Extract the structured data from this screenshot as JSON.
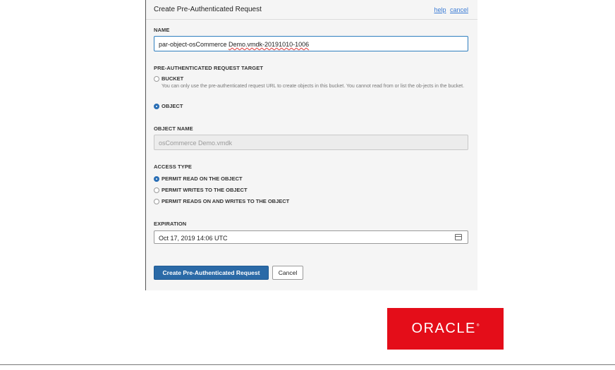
{
  "dialog": {
    "title": "Create Pre-Authenticated Request",
    "help_link": "help",
    "cancel_link": "cancel"
  },
  "name": {
    "label": "NAME",
    "value_prefix": "par-object-osCommerce ",
    "value_flagged": "Demo.vmdk-20191010-1006"
  },
  "target": {
    "label": "PRE-AUTHENTICATED REQUEST TARGET",
    "options": [
      {
        "label": "BUCKET",
        "selected": false,
        "help": "You can only use the pre-authenticated request URL to create objects in this bucket. You cannot read from or list the ob-jects in the bucket."
      },
      {
        "label": "OBJECT",
        "selected": true
      }
    ]
  },
  "object_name": {
    "label": "OBJECT NAME",
    "value": "osCommerce Demo.vmdk"
  },
  "access_type": {
    "label": "ACCESS TYPE",
    "options": [
      {
        "label": "PERMIT READ ON THE OBJECT",
        "selected": true
      },
      {
        "label": "PERMIT WRITES TO THE OBJECT",
        "selected": false
      },
      {
        "label": "PERMIT READS ON AND WRITES TO THE OBJECT",
        "selected": false
      }
    ]
  },
  "expiration": {
    "label": "EXPIRATION",
    "value": "Oct 17, 2019 14:06 UTC",
    "icon": "calendar-icon"
  },
  "buttons": {
    "create": "Create Pre-Authenticated Request",
    "cancel": "Cancel"
  },
  "brand": {
    "logo_text": "ORACLE",
    "logo_mark": "®",
    "color": "#e40d19"
  },
  "colors": {
    "accent": "#2b6aa7",
    "panel_bg": "#f5f5f5"
  }
}
